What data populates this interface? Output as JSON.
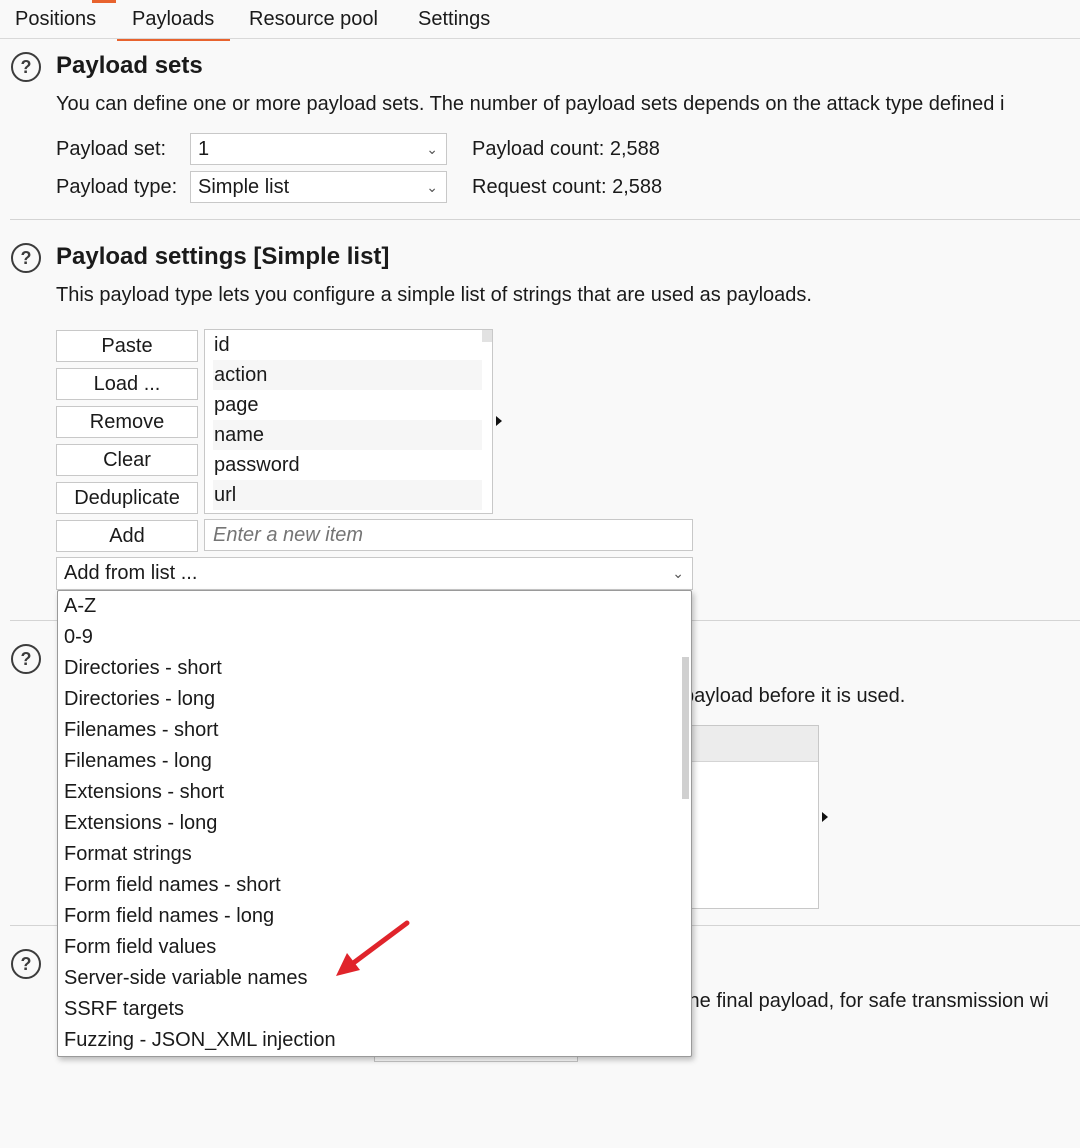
{
  "tabs": [
    {
      "label": "Positions"
    },
    {
      "label": "Payloads",
      "active": true
    },
    {
      "label": "Resource pool"
    },
    {
      "label": "Settings"
    }
  ],
  "payload_sets": {
    "heading": "Payload sets",
    "description": "You can define one or more payload sets. The number of payload sets depends on the attack type defined i",
    "set_label": "Payload set:",
    "set_value": "1",
    "type_label": "Payload type:",
    "type_value": "Simple list",
    "payload_count": "Payload count: 2,588",
    "request_count": "Request count: 2,588"
  },
  "payload_settings": {
    "heading": "Payload settings [Simple list]",
    "description": "This payload type lets you configure a simple list of strings that are used as payloads.",
    "buttons": {
      "paste": "Paste",
      "load": "Load ...",
      "remove": "Remove",
      "clear": "Clear",
      "deduplicate": "Deduplicate",
      "add": "Add"
    },
    "items": [
      "id",
      "action",
      "page",
      "name",
      "password",
      "url"
    ],
    "new_item_placeholder": "Enter a new item",
    "add_from_list": "Add from list ..."
  },
  "add_from_list_options": [
    "A-Z",
    "0-9",
    "Directories - short",
    "Directories - long",
    "Filenames - short",
    "Filenames - long",
    "Extensions - short",
    "Extensions - long",
    "Format strings",
    "Form field names - short",
    "Form field names - long",
    "Form field values",
    "Server-side variable names",
    "SSRF targets",
    "Fuzzing - JSON_XML injection"
  ],
  "partial_text": {
    "processing_desc_tail": "payload before it is used.",
    "encoding_desc_tail": "the final payload, for safe transmission wi"
  },
  "colors": {
    "accent": "#e8632e",
    "annotation_arrow": "#e0242b"
  }
}
